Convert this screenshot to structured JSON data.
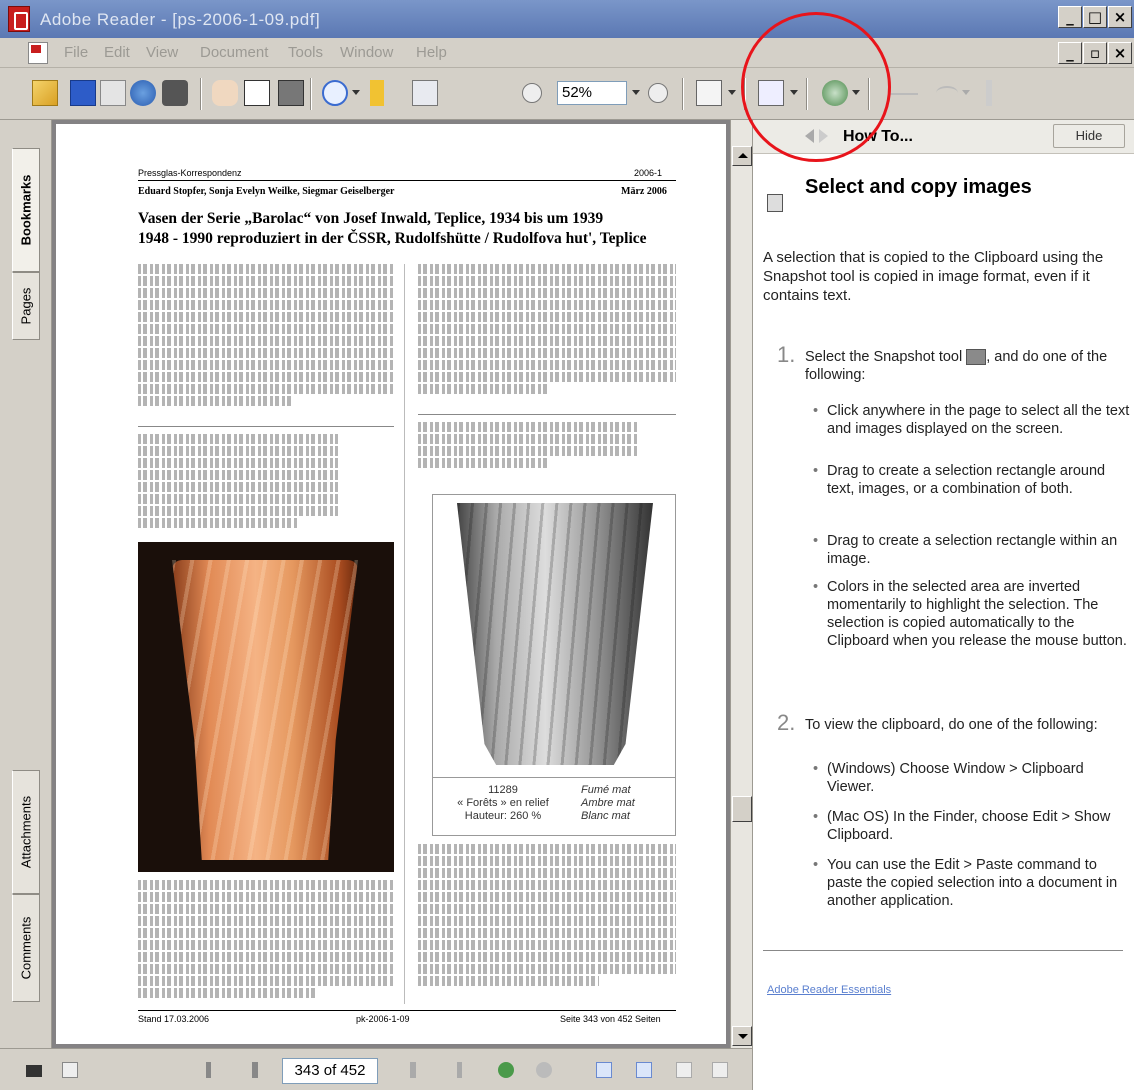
{
  "window": {
    "title": "Adobe Reader - [ps-2006-1-09.pdf]"
  },
  "menu": [
    "File",
    "Edit",
    "View",
    "Document",
    "Tools",
    "Window",
    "Help"
  ],
  "toolbar": {
    "zoom_value": "52%"
  },
  "nav_tabs": {
    "bookmarks": "Bookmarks",
    "pages": "Pages",
    "attachments": "Attachments",
    "comments": "Comments"
  },
  "document": {
    "header_left": "Pressglas-Korrespondenz",
    "header_right": "2006-1",
    "authors": "Eduard Stopfer, Sonja Evelyn Weilke, Siegmar Geiselberger",
    "date": "März 2006",
    "title_line1": "Vasen der Serie „Barolac“ von Josef Inwald, Teplice, 1934 bis um 1939",
    "title_line2": "1948 - 1990 reproduziert in der ČSSR, Rudolfshütte / Rudolfova hut', Teplice",
    "drawing_caption_left": "11289\n« Forêts » en relief\nHauteur: 260 %",
    "drawing_caption_right": "Fumé mat\nAmbre mat\nBlanc mat",
    "footer_left": "Stand 17.03.2006",
    "footer_center": "pk-2006-1-09",
    "footer_right": "Seite 343 von 452 Seiten"
  },
  "howto": {
    "pane_title": "How To...",
    "hide_label": "Hide",
    "heading": "Select and copy images",
    "intro": "A selection that is copied to the Clipboard using the Snapshot tool is copied in image format, even if it contains text.",
    "step1_num": "1.",
    "step1_text_a": "Select the Snapshot tool",
    "step1_text_b": ", and do one of the following:",
    "step1_bullets": [
      "Click anywhere in the page to select all the text and images displayed on the screen.",
      "Drag to create a selection rectangle around text, images, or a combination of both.",
      "Drag to create a selection rectangle within an image.",
      "Colors in the selected area are inverted momentarily to highlight the selection. The selection is copied automatically to the Clipboard when you release the mouse button."
    ],
    "step2_num": "2.",
    "step2_text": "To view the clipboard, do one of the following:",
    "step2_bullets": [
      "(Windows) Choose Window > Clipboard Viewer.",
      "(Mac OS) In the Finder, choose Edit > Show Clipboard.",
      "You can use the Edit > Paste command to paste the copied selection into a document in another application."
    ],
    "link": "Adobe Reader Essentials"
  },
  "status": {
    "page_indicator": "343 of 452"
  },
  "colors": {
    "annotation": "#e8141b",
    "link": "#5a7fcf",
    "titlebar": "#6d88bf"
  }
}
